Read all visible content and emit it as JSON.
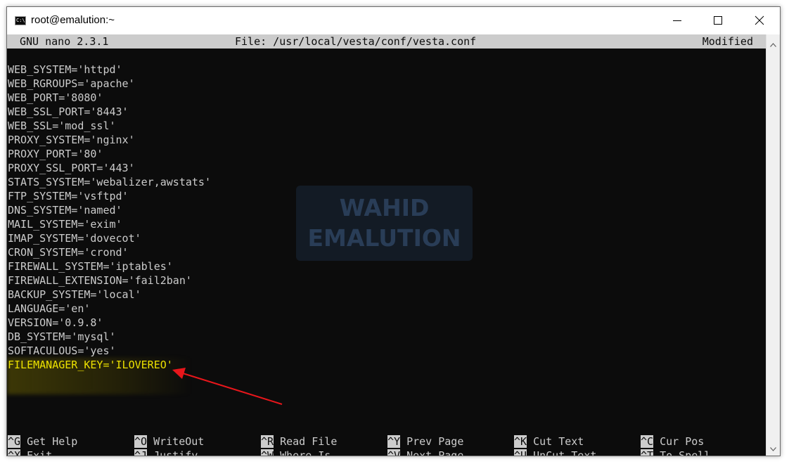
{
  "window": {
    "title": "root@emalution:~",
    "icon": "cmd-icon",
    "icon_text": "C:\\."
  },
  "nano": {
    "version": "GNU nano 2.3.1",
    "file": "File: /usr/local/vesta/conf/vesta.conf",
    "status": "Modified"
  },
  "lines": [
    "WEB_SYSTEM='httpd'",
    "WEB_RGROUPS='apache'",
    "WEB_PORT='8080'",
    "WEB_SSL_PORT='8443'",
    "WEB_SSL='mod_ssl'",
    "PROXY_SYSTEM='nginx'",
    "PROXY_PORT='80'",
    "PROXY_SSL_PORT='443'",
    "STATS_SYSTEM='webalizer,awstats'",
    "FTP_SYSTEM='vsftpd'",
    "DNS_SYSTEM='named'",
    "MAIL_SYSTEM='exim'",
    "IMAP_SYSTEM='dovecot'",
    "CRON_SYSTEM='crond'",
    "FIREWALL_SYSTEM='iptables'",
    "FIREWALL_EXTENSION='fail2ban'",
    "BACKUP_SYSTEM='local'",
    "LANGUAGE='en'",
    "VERSION='0.9.8'",
    "DB_SYSTEM='mysql'",
    "SOFTACULOUS='yes'",
    "FILEMANAGER_KEY='ILOVEREO'"
  ],
  "watermark": {
    "line1": "WAHID",
    "line2": "EMALUTION"
  },
  "shortcuts": [
    {
      "key": "^G",
      "label": "Get Help"
    },
    {
      "key": "^X",
      "label": "Exit"
    },
    {
      "key": "^O",
      "label": "WriteOut"
    },
    {
      "key": "^J",
      "label": "Justify"
    },
    {
      "key": "^R",
      "label": "Read File"
    },
    {
      "key": "^W",
      "label": "Where Is"
    },
    {
      "key": "^Y",
      "label": "Prev Page"
    },
    {
      "key": "^V",
      "label": "Next Page"
    },
    {
      "key": "^K",
      "label": "Cut Text"
    },
    {
      "key": "^U",
      "label": "UnCut Text"
    },
    {
      "key": "^C",
      "label": "Cur Pos"
    },
    {
      "key": "^T",
      "label": "To Spell"
    }
  ],
  "colors": {
    "terminal_bg": "#0c0c0c",
    "terminal_fg": "#cccccc",
    "highlight": "#ece100",
    "arrow": "#e8161b"
  }
}
